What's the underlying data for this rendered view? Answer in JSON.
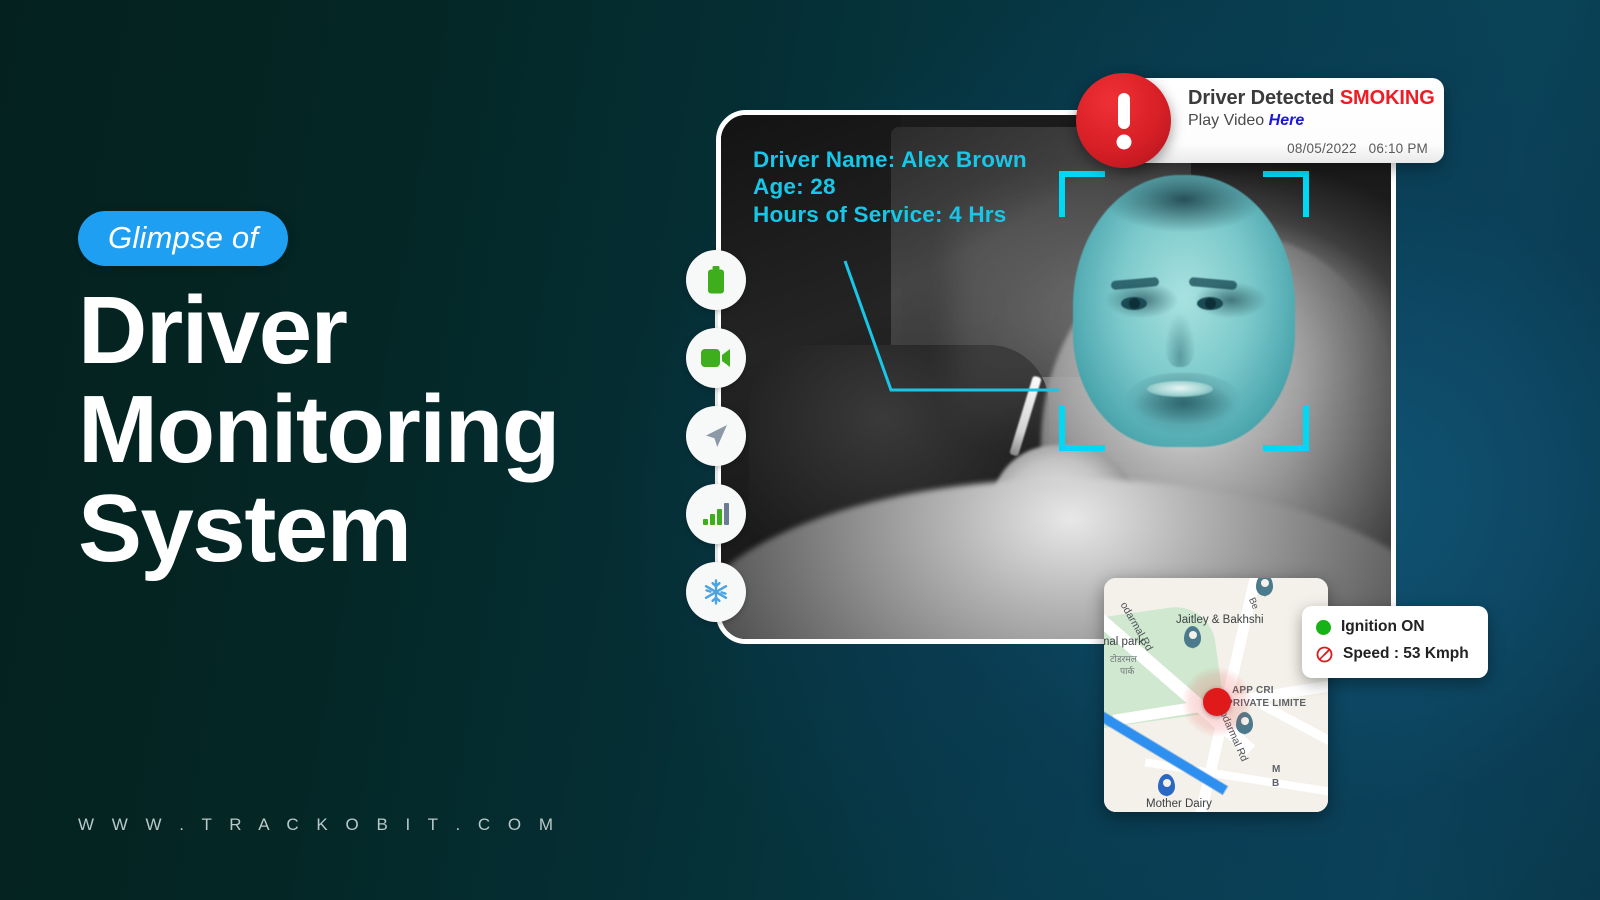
{
  "background": {
    "gradient_from": "#04211F",
    "gradient_to": "#0A4358"
  },
  "left": {
    "badge_label": "Glimpse of",
    "badge_color": "#1E9FF2",
    "headline": "Driver\nMonitoring\nSystem",
    "headline_color": "#FFFFFF",
    "site_url": "W W W . T R A C K O B I T . C O M"
  },
  "video_panel": {
    "driver_info": "Driver Name: Alex Brown\nAge: 28\nHours of Service: 4 Hrs",
    "driver_info_color": "#18C6E8",
    "face_bracket_color": "#00D8F5",
    "border_color": "#FFFFFF"
  },
  "icon_rail": {
    "items": [
      {
        "icon": "video-camera-icon",
        "color": "#3FAE1D"
      },
      {
        "icon": "navigation-arrow-icon",
        "color": "#8D99A6"
      },
      {
        "icon": "signal-bars-icon",
        "color": "#3FAE1D"
      },
      {
        "icon": "snowflake-icon",
        "color": "#4BA3E3"
      },
      {
        "icon": "battery-icon",
        "color": "#3FAE1D"
      }
    ]
  },
  "alert": {
    "icon": "exclamation-alert-icon",
    "icon_color": "#D71F26",
    "title_prefix": "Driver Detected ",
    "title_highlight": "SMOKING",
    "highlight_color": "#EF1C25",
    "sub_prefix": "Play Video ",
    "sub_link": "Here",
    "link_color": "#1A17D6",
    "date": "08/05/2022",
    "time": "06:10 PM"
  },
  "map": {
    "labels": {
      "road_top": "odarmal Rd",
      "park_en": "rmal park",
      "park_hi": "टोडरमल",
      "park_hi2": "पार्क",
      "poi_1": "Jaitley & Bakhshi",
      "company_1": "APP   CRI",
      "company_2": "PRIVATE LIMITE",
      "road_right": "Todarmal Rd",
      "road_be": "Be",
      "poi_2": "Mother Dairy",
      "poi_3a": "M",
      "poi_3b": "B"
    },
    "vehicle_marker_color": "#E01A1A",
    "route_color": "#2D8FF0"
  },
  "status": {
    "ignition": {
      "icon": "green-dot-icon",
      "label": "Ignition ON",
      "color": "#17B217"
    },
    "speed": {
      "icon": "speedometer-icon",
      "label": "Speed : 53 Kmph",
      "color": "#E01A1A"
    }
  }
}
